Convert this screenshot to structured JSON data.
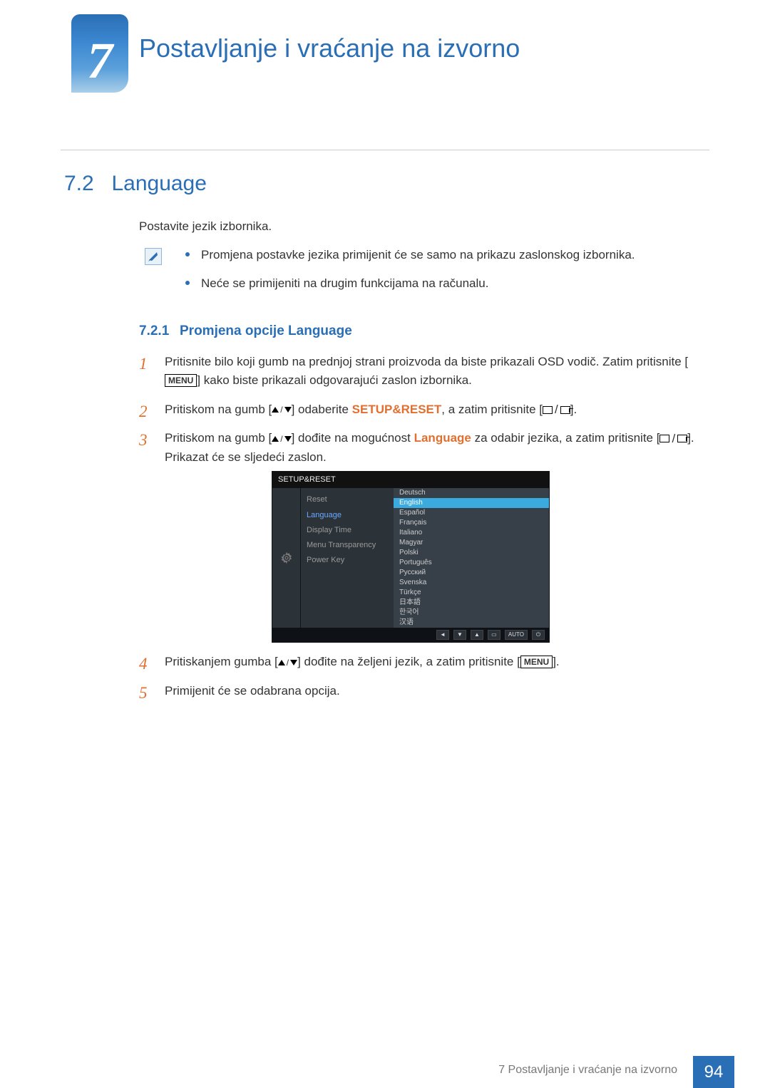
{
  "chapter": {
    "number": "7",
    "title": "Postavljanje i vraćanje na izvorno"
  },
  "section": {
    "number": "7.2",
    "title": "Language"
  },
  "intro": "Postavite jezik izbornika.",
  "notes": [
    "Promjena postavke jezika primijenit će se samo na prikazu zaslonskog izbornika.",
    "Neće se primijeniti na drugim funkcijama na računalu."
  ],
  "subsection": {
    "number": "7.2.1",
    "title": "Promjena opcije Language"
  },
  "steps": {
    "s1_a": "Pritisnite bilo koji gumb na prednjoj strani proizvoda da biste prikazali OSD vodič. Zatim pritisnite [",
    "s1_menu": "MENU",
    "s1_b": "] kako biste prikazali odgovarajući zaslon izbornika.",
    "s2_a": "Pritiskom na gumb [",
    "s2_b": "] odaberite ",
    "s2_hl": "SETUP&RESET",
    "s2_c": ", a zatim pritisnite [",
    "s2_d": "].",
    "s3_a": "Pritiskom na gumb [",
    "s3_b": "] dođite na mogućnost ",
    "s3_hl": "Language",
    "s3_c": " za odabir jezika, a zatim pritisnite [",
    "s3_d": "]. Prikazat će se sljedeći zaslon.",
    "s4_a": "Pritiskanjem gumba [",
    "s4_b": "] dođite na željeni jezik, a zatim pritisnite [",
    "s4_menu": "MENU",
    "s4_c": "].",
    "s5": "Primijenit će se odabrana opcija."
  },
  "osd": {
    "title": "SETUP&RESET",
    "menu": [
      "Reset",
      "Language",
      "Display Time",
      "Menu Transparency",
      "Power Key"
    ],
    "selected_menu": "Language",
    "languages": [
      "Deutsch",
      "English",
      "Español",
      "Français",
      "Italiano",
      "Magyar",
      "Polski",
      "Português",
      "Русский",
      "Svenska",
      "Türkçe",
      "日本語",
      "한국어",
      "汉语"
    ],
    "selected_language": "English",
    "footer_auto": "AUTO"
  },
  "footer": {
    "text": "7 Postavljanje i vraćanje na izvorno",
    "page": "94"
  }
}
